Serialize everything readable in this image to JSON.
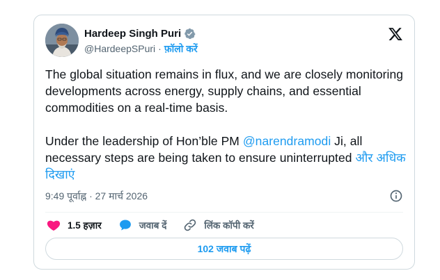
{
  "author": {
    "display_name": "Hardeep Singh Puri",
    "handle": "@HardeepSPuri",
    "separator": "·",
    "follow_label": "फ़ॉलो करें"
  },
  "tweet": {
    "paragraph1": "The global situation remains in flux, and we are closely monitoring developments across energy, supply chains, and essential commodities on a real-time basis.",
    "p2_prefix": "Under the leadership of Hon’ble PM ",
    "p2_mention": "@narendramodi",
    "p2_suffix": " Ji, all necessary steps are being taken to ensure uninterrupted ",
    "show_more_label": "और अधिक दिखाएं"
  },
  "meta": {
    "timestamp": "9:49 पूर्वाह्न · 27 मार्च 2026"
  },
  "actions": {
    "likes_count": "1.5 हज़ार",
    "reply_label": "जवाब दें",
    "copy_link_label": "लिंक कॉपी करें"
  },
  "replies_button_label": "102 जवाब पढ़ें",
  "colors": {
    "accent": "#1d9bf0",
    "like": "#f91880",
    "text_primary": "#0f1419",
    "text_secondary": "#536471",
    "border": "#cfd9de"
  },
  "icons": {
    "verified": "verified-badge-icon",
    "brand": "x-logo-icon",
    "info": "info-icon",
    "like": "heart-icon",
    "reply": "speech-bubble-icon",
    "copy_link": "link-icon"
  }
}
